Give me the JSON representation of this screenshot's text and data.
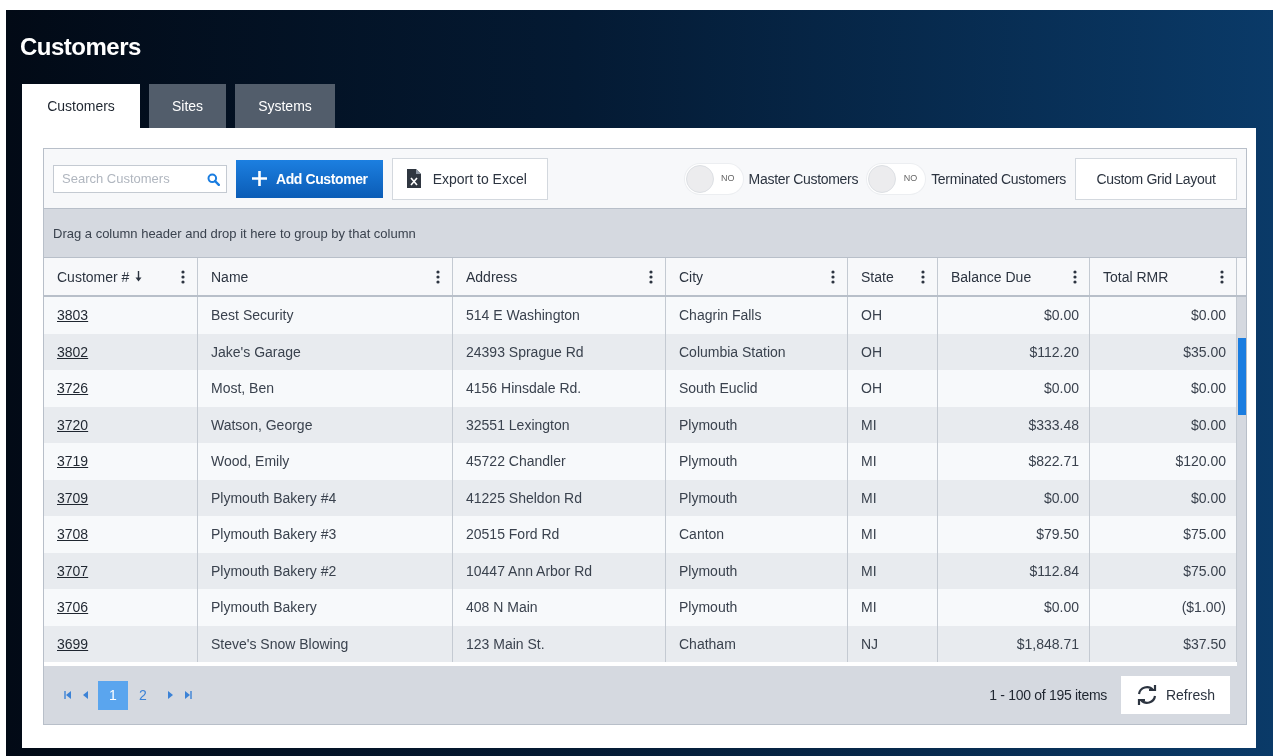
{
  "page_title": "Customers",
  "tabs": [
    {
      "label": "Customers",
      "selected": true
    },
    {
      "label": "Sites",
      "selected": false
    },
    {
      "label": "Systems",
      "selected": false
    }
  ],
  "toolbar": {
    "search": {
      "placeholder": "Search Customers"
    },
    "add_button": "Add Customer",
    "export_button": "Export to Excel",
    "toggles": [
      {
        "state_label": "NO",
        "label": "Master Customers",
        "on": false
      },
      {
        "state_label": "NO",
        "label": "Terminated Customers",
        "on": false
      }
    ],
    "layout_button": "Custom Grid Layout"
  },
  "group_hint": "Drag a column header and drop it here to group by that column",
  "table": {
    "columns": [
      {
        "label": "Customer #",
        "sorted_descending": true
      },
      {
        "label": "Name",
        "sorted_descending": false
      },
      {
        "label": "Address",
        "sorted_descending": false
      },
      {
        "label": "City",
        "sorted_descending": false
      },
      {
        "label": "State",
        "sorted_descending": false
      },
      {
        "label": "Balance Due",
        "sorted_descending": false
      },
      {
        "label": "Total RMR",
        "sorted_descending": false
      }
    ],
    "rows": [
      [
        "3803",
        "Best Security",
        "514 E Washington",
        "Chagrin Falls",
        "OH",
        "$0.00",
        "$0.00"
      ],
      [
        "3802",
        "Jake's Garage",
        "24393 Sprague Rd",
        "Columbia Station",
        "OH",
        "$112.20",
        "$35.00"
      ],
      [
        "3726",
        "Most, Ben",
        "4156 Hinsdale Rd.",
        "South Euclid",
        "OH",
        "$0.00",
        "$0.00"
      ],
      [
        "3720",
        "Watson, George",
        "32551 Lexington",
        "Plymouth",
        "MI",
        "$333.48",
        "$0.00"
      ],
      [
        "3719",
        "Wood, Emily",
        "45722 Chandler",
        "Plymouth",
        "MI",
        "$822.71",
        "$120.00"
      ],
      [
        "3709",
        "Plymouth Bakery #4",
        "41225 Sheldon Rd",
        "Plymouth",
        "MI",
        "$0.00",
        "$0.00"
      ],
      [
        "3708",
        "Plymouth Bakery #3",
        "20515 Ford Rd",
        "Canton",
        "MI",
        "$79.50",
        "$75.00"
      ],
      [
        "3707",
        "Plymouth Bakery #2",
        "10447 Ann Arbor Rd",
        "Plymouth",
        "MI",
        "$112.84",
        "$75.00"
      ],
      [
        "3706",
        "Plymouth Bakery",
        "408 N Main",
        "Plymouth",
        "MI",
        "$0.00",
        "($1.00)"
      ],
      [
        "3699",
        "Steve's Snow Blowing",
        "123 Main St.",
        "Chatham",
        "NJ",
        "$1,848.71",
        "$37.50"
      ]
    ]
  },
  "pager": {
    "pages": [
      {
        "label": "1",
        "selected": true
      },
      {
        "label": "2",
        "selected": false
      }
    ],
    "summary": "1 - 100 of 195 items",
    "refresh_button": "Refresh"
  }
}
